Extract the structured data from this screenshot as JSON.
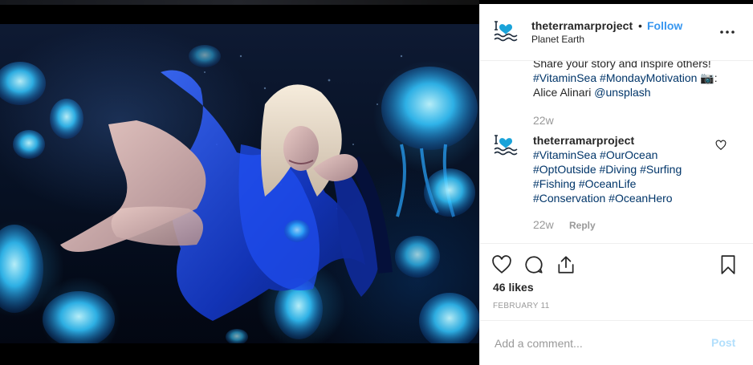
{
  "post": {
    "username": "theterramarproject",
    "separator": "•",
    "follow_label": "Follow",
    "location": "Planet Earth"
  },
  "comments": [
    {
      "lines_visible": [
        {
          "text": "Share your story and inspire others!"
        },
        {
          "parts": [
            "#VitaminSea",
            " ",
            "#MondayMotivation",
            " 📷:"
          ]
        },
        {
          "parts": [
            "Alice Alinari ",
            "@unsplash"
          ]
        }
      ],
      "time": "22w"
    },
    {
      "username": "theterramarproject",
      "hashtags_lines": [
        [
          "#VitaminSea",
          "#OurOcean"
        ],
        [
          "#OptOutside",
          "#Diving",
          "#Surfing"
        ],
        [
          "#Fishing",
          "#OceanLife"
        ],
        [
          "#Conservation",
          "#OceanHero"
        ]
      ],
      "time": "22w",
      "reply_label": "Reply"
    }
  ],
  "actions": {
    "like_icon": "heart-icon",
    "comment_icon": "comment-icon",
    "share_icon": "share-icon",
    "save_icon": "bookmark-icon"
  },
  "likes_text": "46 likes",
  "date_text": "FEBRUARY 11",
  "add_comment": {
    "placeholder": "Add a comment...",
    "post_label": "Post"
  },
  "colors": {
    "link": "#003569",
    "follow": "#3897f0",
    "muted": "#999999",
    "post_disabled": "#b2dffc",
    "logo": "#1aa3d9"
  }
}
